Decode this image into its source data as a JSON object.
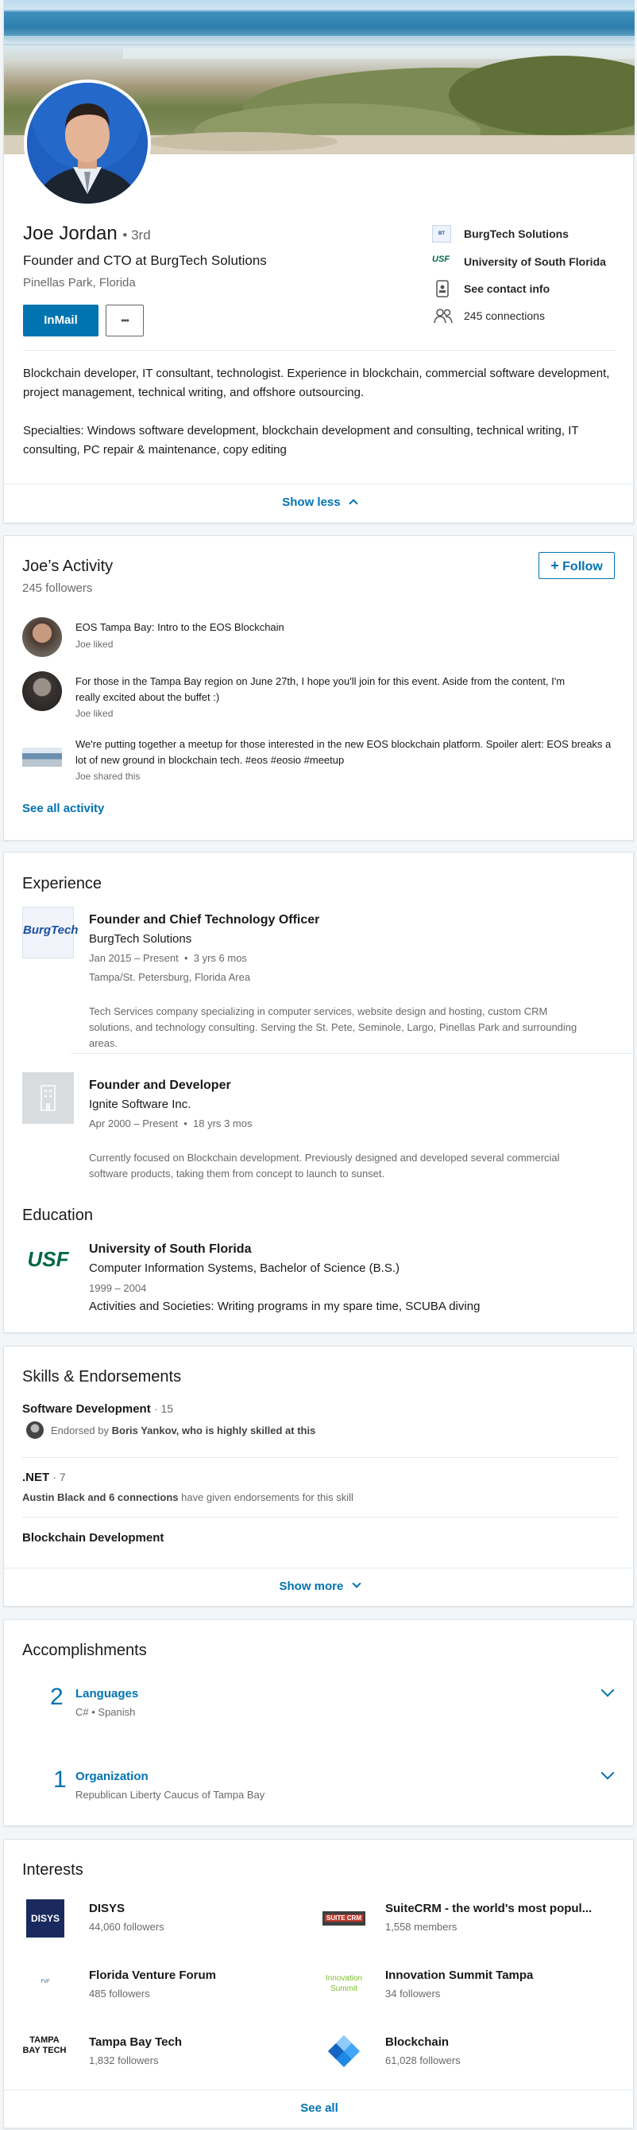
{
  "profile": {
    "name": "Joe Jordan",
    "degree": "• 3rd",
    "headline": "Founder and CTO at BurgTech Solutions",
    "location": "Pinellas Park, Florida",
    "inmail_label": "InMail",
    "more_label": "•••",
    "side": {
      "company": "BurgTech Solutions",
      "school": "University of South Florida",
      "contact": "See contact info",
      "connections": "245 connections"
    },
    "about_1": "Blockchain developer, IT consultant, technologist. Experience in blockchain, commercial software development, project management, technical writing, and offshore outsourcing.",
    "about_2": "Specialties: Windows software development, blockchain development and consulting, technical writing, IT consulting, PC repair & maintenance, copy editing",
    "show_less": "Show less"
  },
  "activity": {
    "title": "Joe’s Activity",
    "followers": "245 followers",
    "follow_label": "Follow",
    "items": [
      {
        "text": "EOS Tampa Bay: Intro to the EOS Blockchain",
        "meta": "Joe liked"
      },
      {
        "text": "For those in the Tampa Bay region on June 27th, I hope you'll join for this event.  Aside from the content, I'm really excited about the buffet :)",
        "meta": "Joe liked"
      },
      {
        "text": "We're putting together a meetup for those interested in the new EOS blockchain platform. Spoiler alert: EOS breaks a lot of new ground in blockchain tech. #eos #eosio #meetup",
        "meta": "Joe shared this"
      }
    ],
    "see_all": "See all activity"
  },
  "experience": {
    "title": "Experience",
    "jobs": [
      {
        "logo_text": "BurgTech",
        "role": "Founder and Chief Technology Officer",
        "company": "BurgTech Solutions",
        "dates": "Jan 2015 – Present",
        "duration": "3 yrs 6 mos",
        "location": "Tampa/St. Petersburg, Florida Area",
        "description": "Tech Services company specializing in computer services, website design and hosting, custom CRM solutions, and technology consulting. Serving the St. Pete, Seminole, Largo, Pinellas Park and surrounding areas."
      },
      {
        "role": "Founder and Developer",
        "company": "Ignite Software Inc.",
        "dates": "Apr 2000 – Present",
        "duration": "18 yrs 3 mos",
        "description": "Currently focused on Blockchain development. Previously designed and developed several commercial software products, taking them from concept to launch to sunset."
      }
    ]
  },
  "education": {
    "title": "Education",
    "logo_text": "USF",
    "school": "University of South Florida",
    "degree": "Computer Information Systems, Bachelor of Science (B.S.)",
    "years": "1999 – 2004",
    "activities": "Activities and Societies: Writing programs in my spare time, SCUBA diving"
  },
  "skills": {
    "title": "Skills & Endorsements",
    "items": [
      {
        "name": "Software Development",
        "count": "· 15",
        "endorse_prefix": "Endorsed by ",
        "endorse_bold": "Boris Yankov, who is highly skilled at this"
      },
      {
        "name": ".NET",
        "count": "· 7",
        "endorse_bold": "Austin Black and 6 connections",
        "endorse_suffix": " have given endorsements for this skill"
      },
      {
        "name": "Blockchain Development"
      }
    ],
    "show_more": "Show more"
  },
  "accomplishments": {
    "title": "Accomplishments",
    "groups": [
      {
        "count": "2",
        "label": "Languages",
        "detail": "C#  •  Spanish"
      },
      {
        "count": "1",
        "label": "Organization",
        "detail": "Republican Liberty Caucus of Tampa Bay"
      }
    ]
  },
  "interests": {
    "title": "Interests",
    "items": [
      {
        "name": "DISYS",
        "sub": "44,060 followers",
        "logo": "DISYS"
      },
      {
        "name": "SuiteCRM - the world's most popul...",
        "sub": "1,558 members",
        "logo": "SUITE CRM"
      },
      {
        "name": "Florida Venture Forum",
        "sub": "485 followers",
        "logo": "FVF"
      },
      {
        "name": "Innovation Summit Tampa",
        "sub": "34 followers",
        "logo": "Innovation Summit"
      },
      {
        "name": "Tampa Bay Tech",
        "sub": "1,832 followers",
        "logo": "TAMPA BAY TECH"
      },
      {
        "name": "Blockchain",
        "sub": "61,028 followers",
        "logo": ""
      }
    ],
    "see_all": "See all"
  },
  "colors": {
    "accent": "#0073b1",
    "bg": "#f3f6f8"
  }
}
